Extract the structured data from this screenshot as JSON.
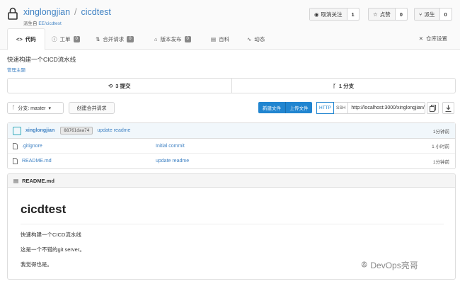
{
  "repo": {
    "owner": "xinglongjian",
    "separator": "/",
    "name": "cicdtest",
    "fork_label": "派生自",
    "fork_source": "EE/cicdtest"
  },
  "actions": {
    "watch": {
      "label": "取消关注",
      "count": "1"
    },
    "star": {
      "label": "点赞",
      "count": "0"
    },
    "fork": {
      "label": "派生",
      "count": "0"
    }
  },
  "tabs": [
    {
      "label": "代码",
      "badge": ""
    },
    {
      "label": "工单",
      "badge": "0"
    },
    {
      "label": "合并请求",
      "badge": "0"
    },
    {
      "label": "版本发布",
      "badge": "0"
    },
    {
      "label": "百科",
      "badge": ""
    },
    {
      "label": "动态",
      "badge": ""
    }
  ],
  "settings_label": "仓库设置",
  "description": "快速构建一个CICD流水线",
  "manage_topics": "管理主题",
  "stats": {
    "commits": "3 提交",
    "branches": "1 分支"
  },
  "branch_label": "分支: master",
  "new_pr": "创建合并请求",
  "new_file": "新建文件",
  "upload_file": "上传文件",
  "clone": {
    "http": "HTTP",
    "ssh": "SSH",
    "url": "http://localhost:3000/xinglongjian/cicdtest.git"
  },
  "latest_commit": {
    "author": "xinglongjian",
    "sha": "88761daa74",
    "message": "update readme",
    "time": "1分钟前"
  },
  "files": [
    {
      "name": ".gitignore",
      "message": "Initial commit",
      "time": "1 小时前"
    },
    {
      "name": "README.md",
      "message": "update readme",
      "time": "1分钟前"
    }
  ],
  "readme": {
    "filename": "README.md",
    "title": "cicdtest",
    "lines": [
      "快速构建一个CICD流水线",
      "这是一个不错的git server。",
      "我觉得也是。"
    ]
  },
  "watermark": "DevOps亮哥",
  "colors": {
    "link": "#4183c4",
    "primary": "#2185d0"
  }
}
